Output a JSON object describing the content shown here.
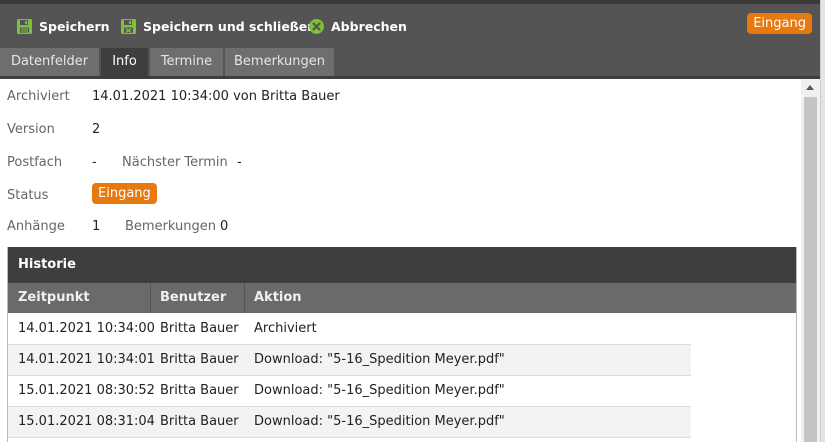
{
  "toolbar": {
    "save_label": "Speichern",
    "save_close_label": "Speichern und schließen",
    "cancel_label": "Abbrechen",
    "status_badge": "Eingang",
    "save_icon": "floppy-disk-icon",
    "save_close_icon": "floppy-disk-close-icon",
    "cancel_icon": "cancel-circle-icon",
    "colors": {
      "background": "#545454",
      "icon_green": "#7fbf3a",
      "badge": "#e8790f"
    }
  },
  "tabs": [
    {
      "label": "Datenfelder",
      "active": false
    },
    {
      "label": "Info",
      "active": true
    },
    {
      "label": "Termine",
      "active": false
    },
    {
      "label": "Bemerkungen",
      "active": false
    }
  ],
  "info": {
    "archived_label": "Archiviert",
    "archived_value": "14.01.2021 10:34:00 von Britta Bauer",
    "version_label": "Version",
    "version_value": "2",
    "postfach_label": "Postfach",
    "postfach_value": "-",
    "next_appointment_label": "Nächster Termin",
    "next_appointment_value": "-",
    "status_label": "Status",
    "status_value": "Eingang",
    "attachments_label": "Anhänge",
    "attachments_value": "1",
    "remarks_label": "Bemerkungen",
    "remarks_value": "0"
  },
  "history": {
    "title": "Historie",
    "columns": [
      "Zeitpunkt",
      "Benutzer",
      "Aktion"
    ],
    "rows": [
      {
        "time": "14.01.2021 10:34:00",
        "user": "Britta Bauer",
        "action": "Archiviert"
      },
      {
        "time": "14.01.2021 10:34:01",
        "user": "Britta Bauer",
        "action": "Download: \"5-16_Spedition Meyer.pdf\""
      },
      {
        "time": "15.01.2021 08:30:52",
        "user": "Britta Bauer",
        "action": "Download: \"5-16_Spedition Meyer.pdf\""
      },
      {
        "time": "15.01.2021 08:31:04",
        "user": "Britta Bauer",
        "action": "Download: \"5-16_Spedition Meyer.pdf\""
      }
    ]
  }
}
